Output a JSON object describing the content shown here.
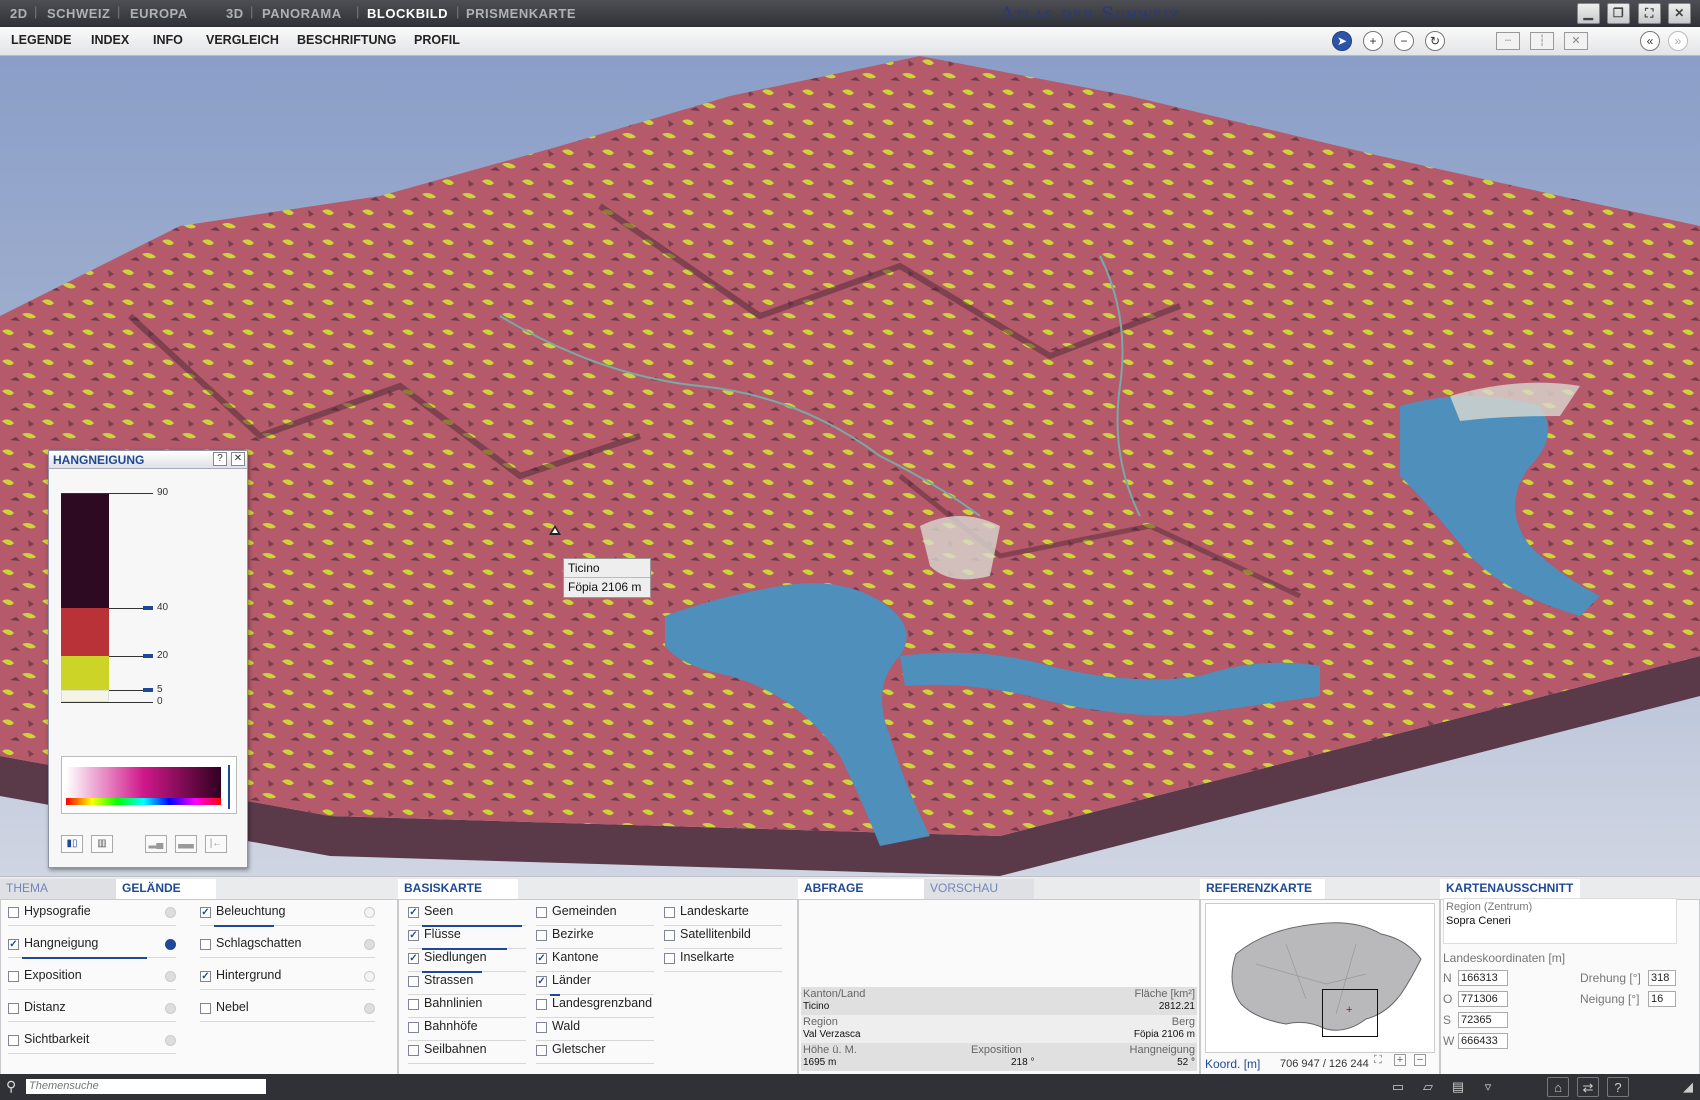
{
  "topbar": {
    "mode_2d": "2D",
    "schweiz": "SCHWEIZ",
    "europa": "EUROPA",
    "mode_3d": "3D",
    "panorama": "PANORAMA",
    "blockbild": "BLOCKBILD",
    "prismenkarte": "PRISMENKARTE",
    "title": "Atlas der Schweiz",
    "separator": "|"
  },
  "menu": {
    "legende": "LEGENDE",
    "index": "INDEX",
    "info": "INFO",
    "vergleich": "VERGLEICH",
    "beschriftung": "BESCHRIFTUNG",
    "profil": "PROFIL"
  },
  "tooltip": {
    "region": "Ticino",
    "peak": "Föpia   2106 m"
  },
  "legend": {
    "title": "HANGNEIGUNG",
    "help": "?",
    "close": "✕",
    "ticks": [
      "90",
      "40",
      "20",
      "5",
      "0"
    ],
    "colors": {
      "steep": "#2d0a22",
      "medium": "#b83238",
      "gentle": "#ccd527",
      "flat": "#f5f5e6"
    }
  },
  "tabs": {
    "thema": "THEMA",
    "gelaende": "GELÄNDE",
    "basiskarte": "BASISKARTE",
    "abfrage": "ABFRAGE",
    "vorschau": "VORSCHAU",
    "referenzkarte": "REFERENZKARTE",
    "kartenausschnitt": "KARTENAUSSCHNITT"
  },
  "gelaende": {
    "col1": [
      {
        "label": "Hypsografie",
        "checked": "",
        "on": false
      },
      {
        "label": "Hangneigung",
        "checked": "✓",
        "on": true
      },
      {
        "label": "Exposition",
        "checked": "",
        "on": false
      },
      {
        "label": "Distanz",
        "checked": "",
        "on": false
      },
      {
        "label": "Sichtbarkeit",
        "checked": "",
        "on": false
      }
    ],
    "col2": [
      {
        "label": "Beleuchtung",
        "checked": "✓"
      },
      {
        "label": "Schlagschatten",
        "checked": ""
      },
      {
        "label": "Hintergrund",
        "checked": "✓"
      },
      {
        "label": "Nebel",
        "checked": ""
      }
    ]
  },
  "basiskarte": {
    "col1": [
      {
        "label": "Seen",
        "checked": "✓"
      },
      {
        "label": "Flüsse",
        "checked": "✓"
      },
      {
        "label": "Siedlungen",
        "checked": "✓"
      },
      {
        "label": "Strassen",
        "checked": ""
      },
      {
        "label": "Bahnlinien",
        "checked": ""
      },
      {
        "label": "Bahnhöfe",
        "checked": ""
      },
      {
        "label": "Seilbahnen",
        "checked": ""
      }
    ],
    "col2": [
      {
        "label": "Gemeinden",
        "checked": ""
      },
      {
        "label": "Bezirke",
        "checked": ""
      },
      {
        "label": "Kantone",
        "checked": "✓"
      },
      {
        "label": "Länder",
        "checked": "✓"
      },
      {
        "label": "Landesgrenzband",
        "checked": ""
      },
      {
        "label": "Wald",
        "checked": ""
      },
      {
        "label": "Gletscher",
        "checked": ""
      }
    ],
    "col3": [
      {
        "label": "Landeskarte",
        "checked": ""
      },
      {
        "label": "Satellitenbild",
        "checked": ""
      },
      {
        "label": "Inselkarte",
        "checked": ""
      }
    ]
  },
  "abfrage": {
    "kanton_lbl": "Kanton/Land",
    "kanton_val": "Ticino",
    "flaeche_lbl": "Fläche [km²]",
    "flaeche_val": "2812.21",
    "region_lbl": "Region",
    "region_val": "Val Verzasca",
    "berg_lbl": "Berg",
    "berg_val": "Föpia   2106 m",
    "hoehe_lbl": "Höhe ü. M.",
    "hoehe_val": "1695 m",
    "exposition_lbl": "Exposition",
    "exposition_val": "218 °",
    "hangneigung_lbl": "Hangneigung",
    "hangneigung_val": "52 °"
  },
  "referenz": {
    "koord_lbl": "Koord. [m]",
    "koord_val": "706 947 / 126 244"
  },
  "kartenausschnitt": {
    "region_lbl": "Region (Zentrum)",
    "region_val": "Sopra Ceneri",
    "landeskoord_lbl": "Landeskoordinaten [m]",
    "n_lbl": "N",
    "n_val": "166313",
    "o_lbl": "O",
    "o_val": "771306",
    "s_lbl": "S",
    "s_val": "72365",
    "w_lbl": "W",
    "w_val": "666433",
    "drehung_lbl": "Drehung [°]",
    "drehung_val": "318",
    "neigung_lbl": "Neigung [°]",
    "neigung_val": "16"
  },
  "status": {
    "search_placeholder": "Themensuche"
  }
}
